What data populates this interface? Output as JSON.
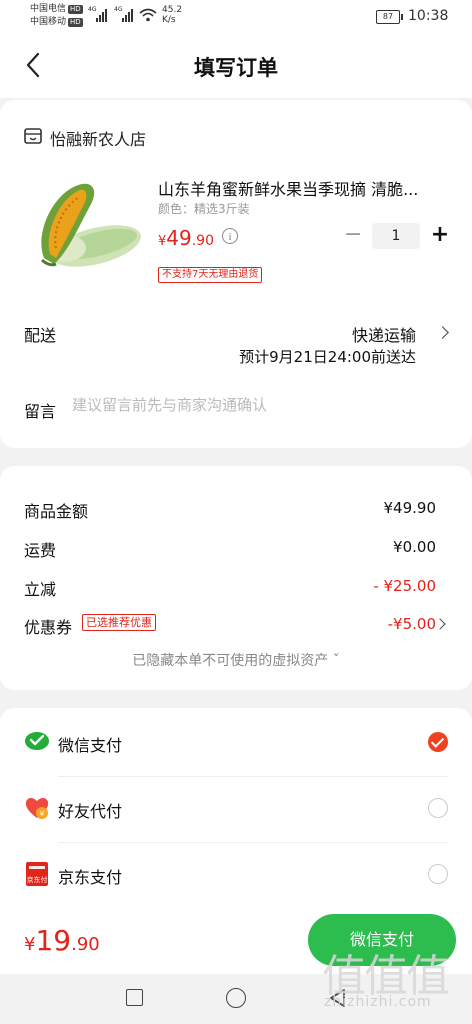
{
  "status_bar": {
    "carrier1": "中国电信",
    "carrier2": "中国移动",
    "hd": "HD",
    "net": "4G",
    "speed_value": "45.2",
    "speed_unit": "K/s",
    "battery": "87",
    "time": "10:38"
  },
  "header": {
    "title": "填写订单"
  },
  "store": {
    "name": "怡融新农人店"
  },
  "product": {
    "title": "山东羊角蜜新鲜水果当季现摘 清脆...",
    "spec": "颜色：精选3斤装",
    "price_symbol": "¥",
    "price_int": "49",
    "price_dec": ".90",
    "quantity": "1",
    "minus": "−",
    "plus": "+",
    "return_tag": "不支持7天无理由退货"
  },
  "shipping": {
    "label": "配送",
    "method": "快递运输",
    "eta": "预计9月21日24:00前送达"
  },
  "note": {
    "label": "留言",
    "placeholder": "建议留言前先与商家沟通确认"
  },
  "summary": {
    "goods_label": "商品金额",
    "goods_value": "¥49.90",
    "freight_label": "运费",
    "freight_value": "¥0.00",
    "discount_label": "立减",
    "discount_value": "- ¥25.00",
    "coupon_label": "优惠券",
    "coupon_badge": "已选推荐优惠",
    "coupon_value": "-¥5.00",
    "hidden_assets": "已隐藏本单不可使用的虚拟资产 ˇ"
  },
  "payment": {
    "methods": [
      {
        "label": "微信支付",
        "icon": "wechat-pay-icon",
        "selected": true
      },
      {
        "label": "好友代付",
        "icon": "friend-pay-icon",
        "selected": false
      },
      {
        "label": "京东支付",
        "icon": "jd-pay-icon",
        "selected": false
      }
    ],
    "jd_icon_text": "京东付"
  },
  "bottom": {
    "total_symbol": "¥",
    "total_int": "19",
    "total_dec": ".90",
    "pay_button": "微信支付"
  },
  "watermark": {
    "chars": "值值值",
    "url": "zhizhizhi.com"
  },
  "colors": {
    "accent_red": "#e2231a",
    "wechat_green": "#2dbd4f",
    "radio_selected": "#f0401e"
  }
}
